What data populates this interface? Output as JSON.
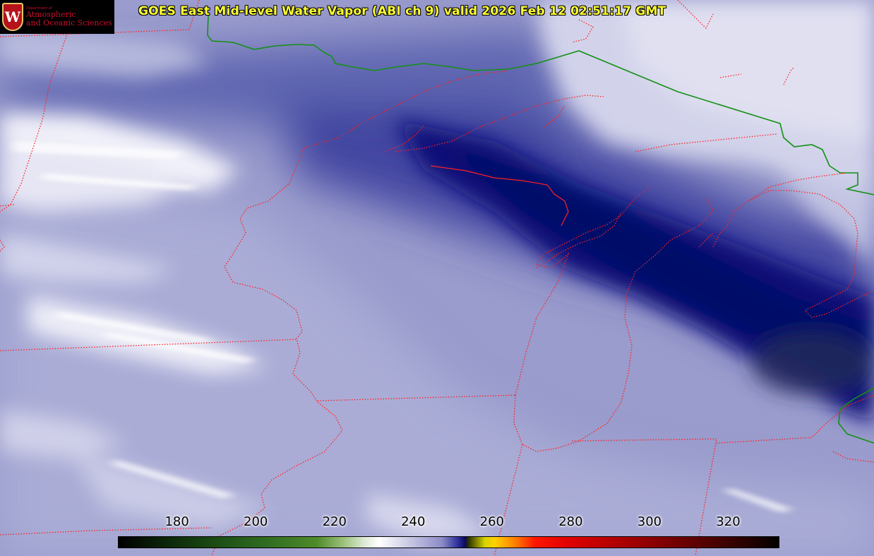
{
  "header": {
    "title": "GOES East Mid-level Water Vapor (ABI ch 9)  valid 2026 Feb 12 02:51:17 GMT"
  },
  "logo": {
    "seal_letter": "W",
    "dept": "Department of",
    "line1": "Atmospheric",
    "line2": "and Oceanic Sciences"
  },
  "map": {
    "product": "Mid-level Water Vapor",
    "satellite": "GOES East",
    "colors": {
      "state_borders": "#ff2020",
      "international_border": "#149014",
      "dry_air": "#00006e",
      "moist_air": "#c8c8e6",
      "high_cloud": "#f2f2fa"
    }
  },
  "colorbar": {
    "unit_hint": "brightness temperature",
    "min": 165,
    "max": 333,
    "ticks": [
      {
        "label": "180",
        "value": 180
      },
      {
        "label": "200",
        "value": 200
      },
      {
        "label": "220",
        "value": 220
      },
      {
        "label": "240",
        "value": 240
      },
      {
        "label": "260",
        "value": 260
      },
      {
        "label": "280",
        "value": 280
      },
      {
        "label": "300",
        "value": 300
      },
      {
        "label": "320",
        "value": 320
      }
    ]
  }
}
